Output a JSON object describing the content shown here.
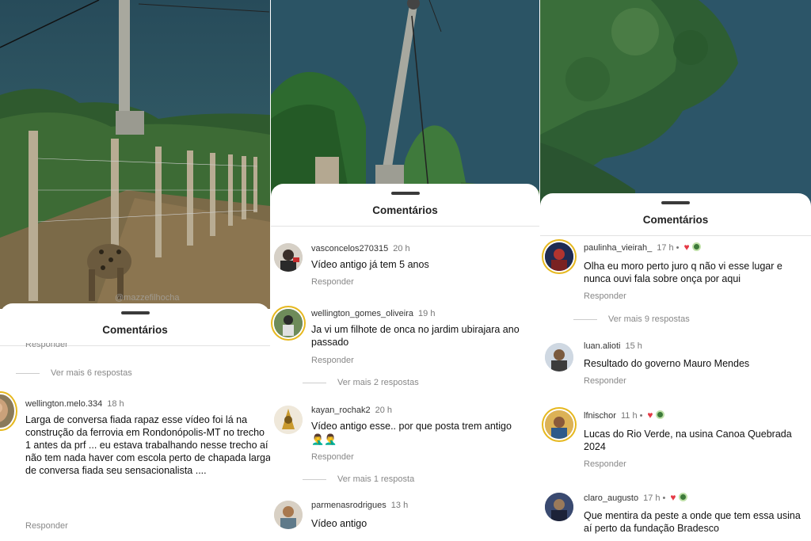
{
  "panel1": {
    "watermark": "@mazzefilhocha",
    "sheet_title": "Comentários",
    "cut_reply": "Responder",
    "more_replies_top": "Ver mais 6 respostas",
    "comment": {
      "user": "wellington.melo.334",
      "time": "18 h",
      "text": "Larga de conversa fiada rapaz esse vídeo foi lá na construção da ferrovia em Rondonópolis-MT no trecho 1 antes da prf ... eu estava trabalhando nesse trecho aí não tem nada haver com escola perto de chapada larga de conversa fiada seu sensacionalista ....",
      "reply": "Responder"
    }
  },
  "panel2": {
    "sheet_title": "Comentários",
    "comments": [
      {
        "user": "vasconcelos270315",
        "time": "20 h",
        "text": "Vídeo antigo já tem 5 anos",
        "reply": "Responder"
      },
      {
        "user": "wellington_gomes_oliveira",
        "time": "19 h",
        "text": "Ja vi um filhote de onca no jardim ubirajara ano passado",
        "reply": "Responder",
        "more": "Ver mais 2 respostas"
      },
      {
        "user": "kayan_rochak2",
        "time": "20 h",
        "text": "Vídeo antigo esse.. por que posta trem antigo",
        "emojis": "🤦‍♂️🤦‍♂️",
        "reply": "Responder",
        "more": "Ver mais 1 resposta"
      },
      {
        "user": "parmenasrodrigues",
        "time": "13 h",
        "text": "Vídeo antigo"
      }
    ]
  },
  "panel3": {
    "sheet_title": "Comentários",
    "comments": [
      {
        "user": "paulinha_vieirah_",
        "time": "17 h",
        "text": "Olha eu moro perto juro q não vi esse lugar e nunca ouvi fala sobre onça por aqui",
        "reply": "Responder",
        "more": "Ver mais 9 respostas"
      },
      {
        "user": "luan.alioti",
        "time": "15 h",
        "text": "Resultado do governo Mauro Mendes",
        "reply": "Responder"
      },
      {
        "user": "lfnischor",
        "time": "11 h",
        "text": "Lucas do Rio Verde,  na usina Canoa Quebrada 2024",
        "reply": "Responder"
      },
      {
        "user": "claro_augusto",
        "time": "17 h",
        "text": "Que mentira da peste a onde que tem essa usina aí perto da fundação Bradesco"
      }
    ],
    "dot": "•"
  },
  "colors": {
    "heart": "#e53945",
    "story_ring": "#e6b81f",
    "sky": "#2a4f5e"
  }
}
